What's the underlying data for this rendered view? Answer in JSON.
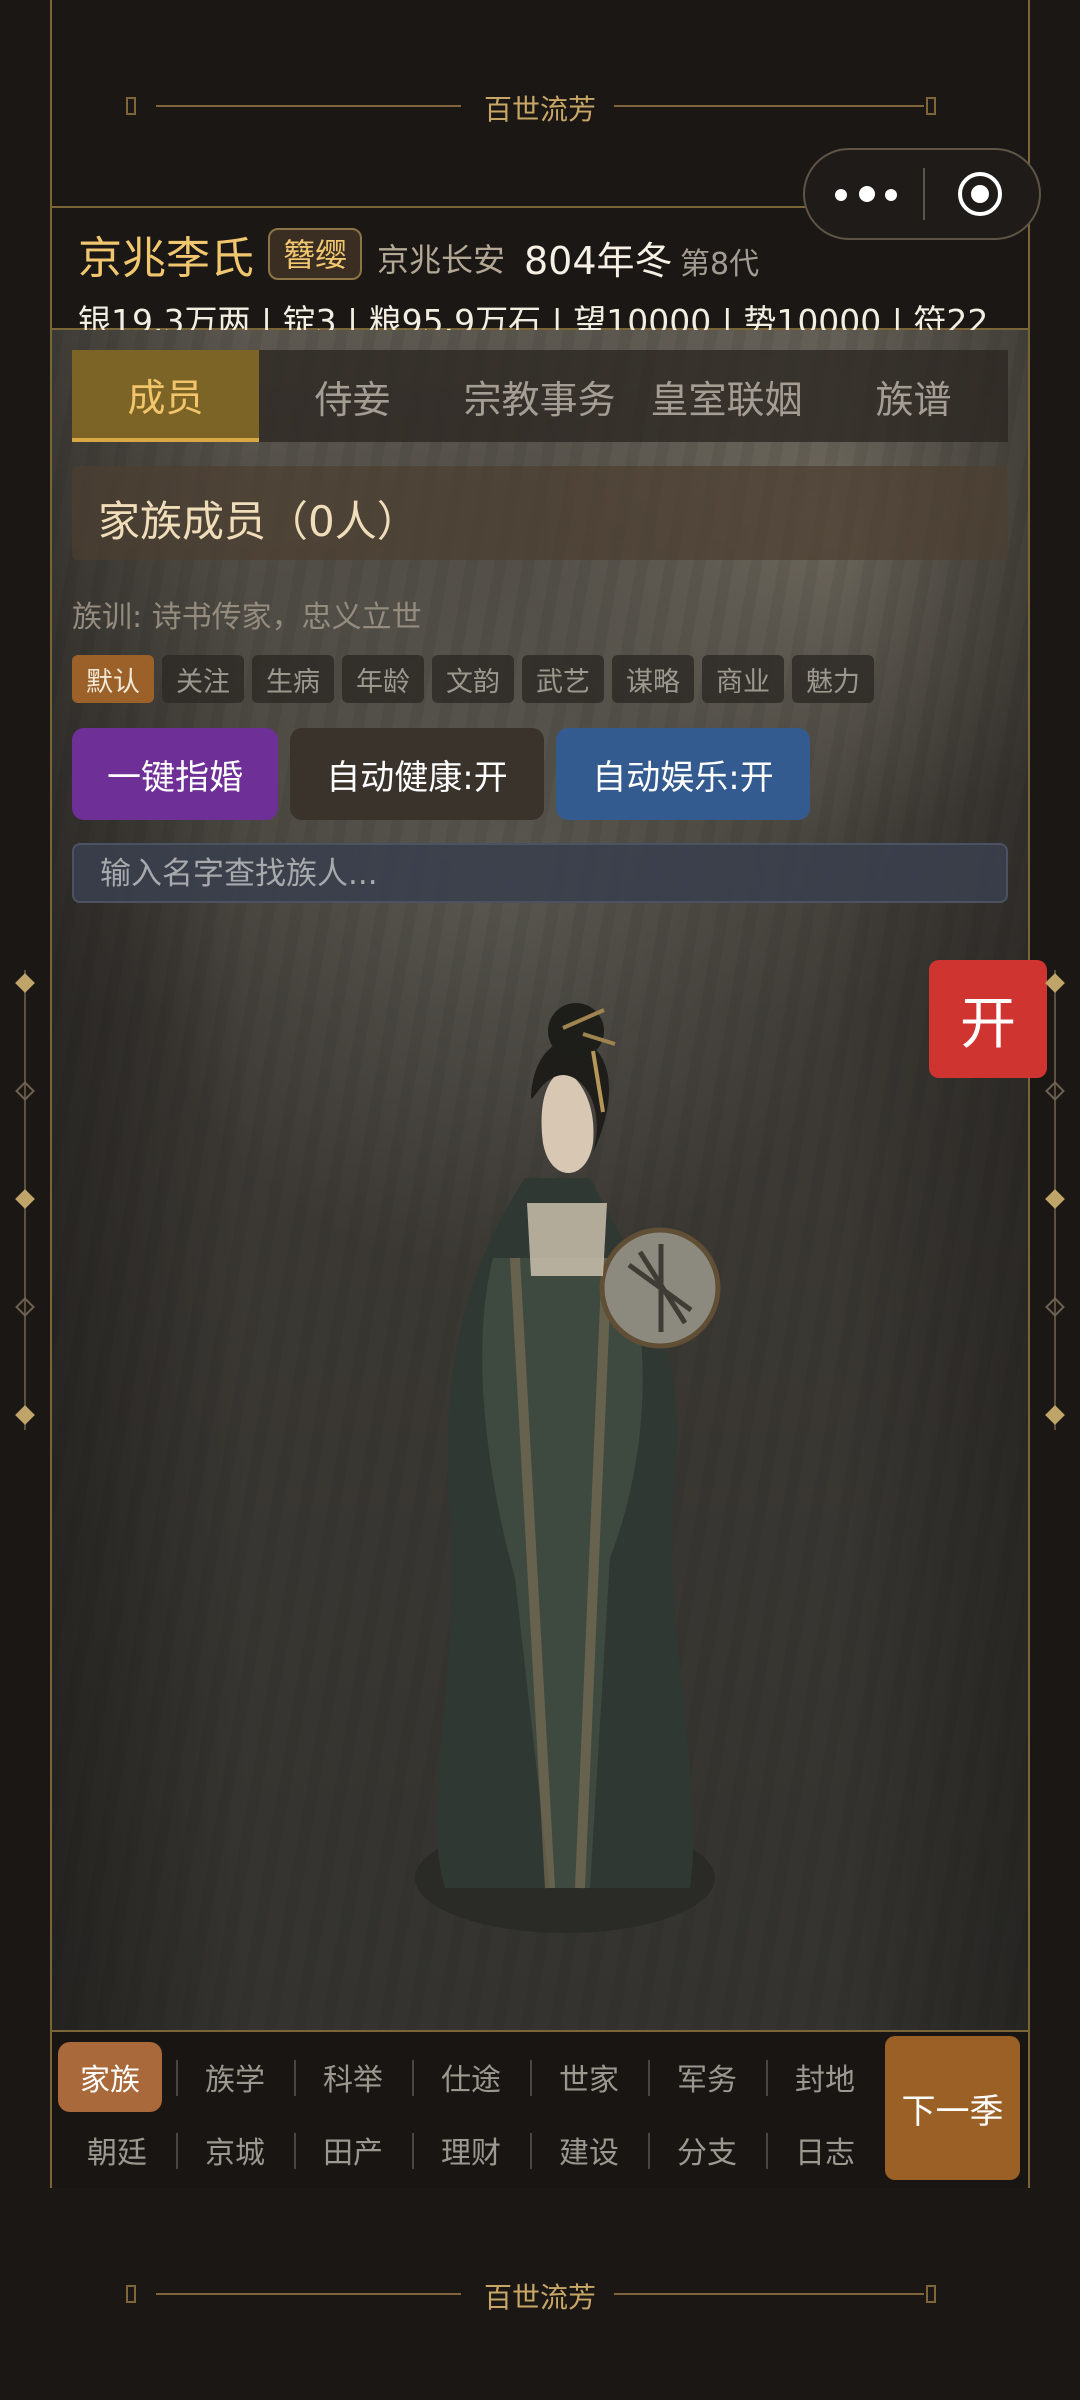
{
  "banner": {
    "top_title": "百世流芳",
    "bottom_title": "百世流芳"
  },
  "header": {
    "clan_name": "京兆李氏",
    "rank_badge": "簪缨",
    "location": "京兆长安",
    "date": "804年冬",
    "generation": "第8代",
    "stats": "银19.3万两 | 锭3 | 粮95.9万石 | 望10000 | 势10000 | 符22"
  },
  "tabs": [
    "成员",
    "侍妾",
    "宗教事务",
    "皇室联姻",
    "族谱"
  ],
  "members": {
    "title": "家族成员（0人）",
    "motto": "族训: 诗书传家，忠义立世"
  },
  "filters": [
    "默认",
    "关注",
    "生病",
    "年龄",
    "文韵",
    "武艺",
    "谋略",
    "商业",
    "魅力"
  ],
  "actions": {
    "marry": "一键指婚",
    "auto_health": "自动健康:开",
    "auto_fun": "自动娱乐:开"
  },
  "search": {
    "placeholder": "输入名字查找族人..."
  },
  "floating_button": "开",
  "bottom_nav": {
    "row1": [
      "家族",
      "族学",
      "科举",
      "仕途",
      "世家",
      "军务",
      "封地"
    ],
    "row2": [
      "朝廷",
      "京城",
      "田产",
      "理财",
      "建设",
      "分支",
      "日志"
    ],
    "next": "下一季"
  },
  "icons": {
    "menu": "more-dots-icon",
    "close": "record-icon"
  },
  "colors": {
    "gold": "#f0c66e",
    "active_tab": "#7c6326",
    "purple_button": "#6e2f96",
    "blue_button": "#345b8f",
    "red_button": "#cf3431",
    "next_button": "#9a6025"
  }
}
